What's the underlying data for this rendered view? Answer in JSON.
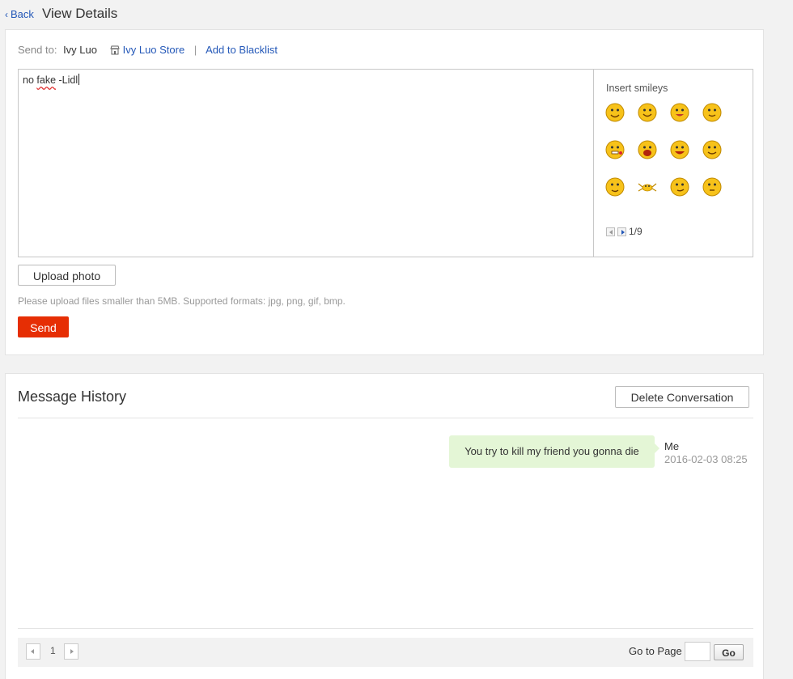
{
  "header": {
    "back_label": "Back",
    "title": "View Details"
  },
  "compose": {
    "send_to_label": "Send to:",
    "recipient_name": "Ivy Luo",
    "store_link": "Ivy Luo Store",
    "separator": "|",
    "blacklist_link": "Add to Blacklist",
    "message_text": {
      "part1": "no ",
      "misspelled": "fake",
      "part2": " -Lidl"
    },
    "smileys": {
      "title": "Insert smileys",
      "page_indicator": "1/9",
      "icons": [
        "smile-icon",
        "wink-icon",
        "tongue-out-icon",
        "giggle-icon",
        "rose-mouth-icon",
        "laugh-icon",
        "tears-of-joy-icon",
        "blush-icon",
        "hug-icon",
        "crab-icon",
        "smirk-icon",
        "thinking-icon"
      ]
    },
    "upload_label": "Upload photo",
    "upload_hint": "Please upload files smaller than 5MB. Supported formats: jpg, png, gif, bmp.",
    "send_label": "Send"
  },
  "history": {
    "title": "Message History",
    "delete_label": "Delete Conversation",
    "messages": [
      {
        "text": "You try to kill my friend you gonna die",
        "sender": "Me",
        "timestamp": "2016-02-03 08:25"
      }
    ],
    "pagination": {
      "current_page": "1",
      "goto_label": "Go to Page",
      "go_label": "Go"
    }
  },
  "colors": {
    "link": "#2458b8",
    "send_button": "#e62e04",
    "bubble": "#e4f6d6",
    "smiley_fill": "#f7c21a"
  }
}
